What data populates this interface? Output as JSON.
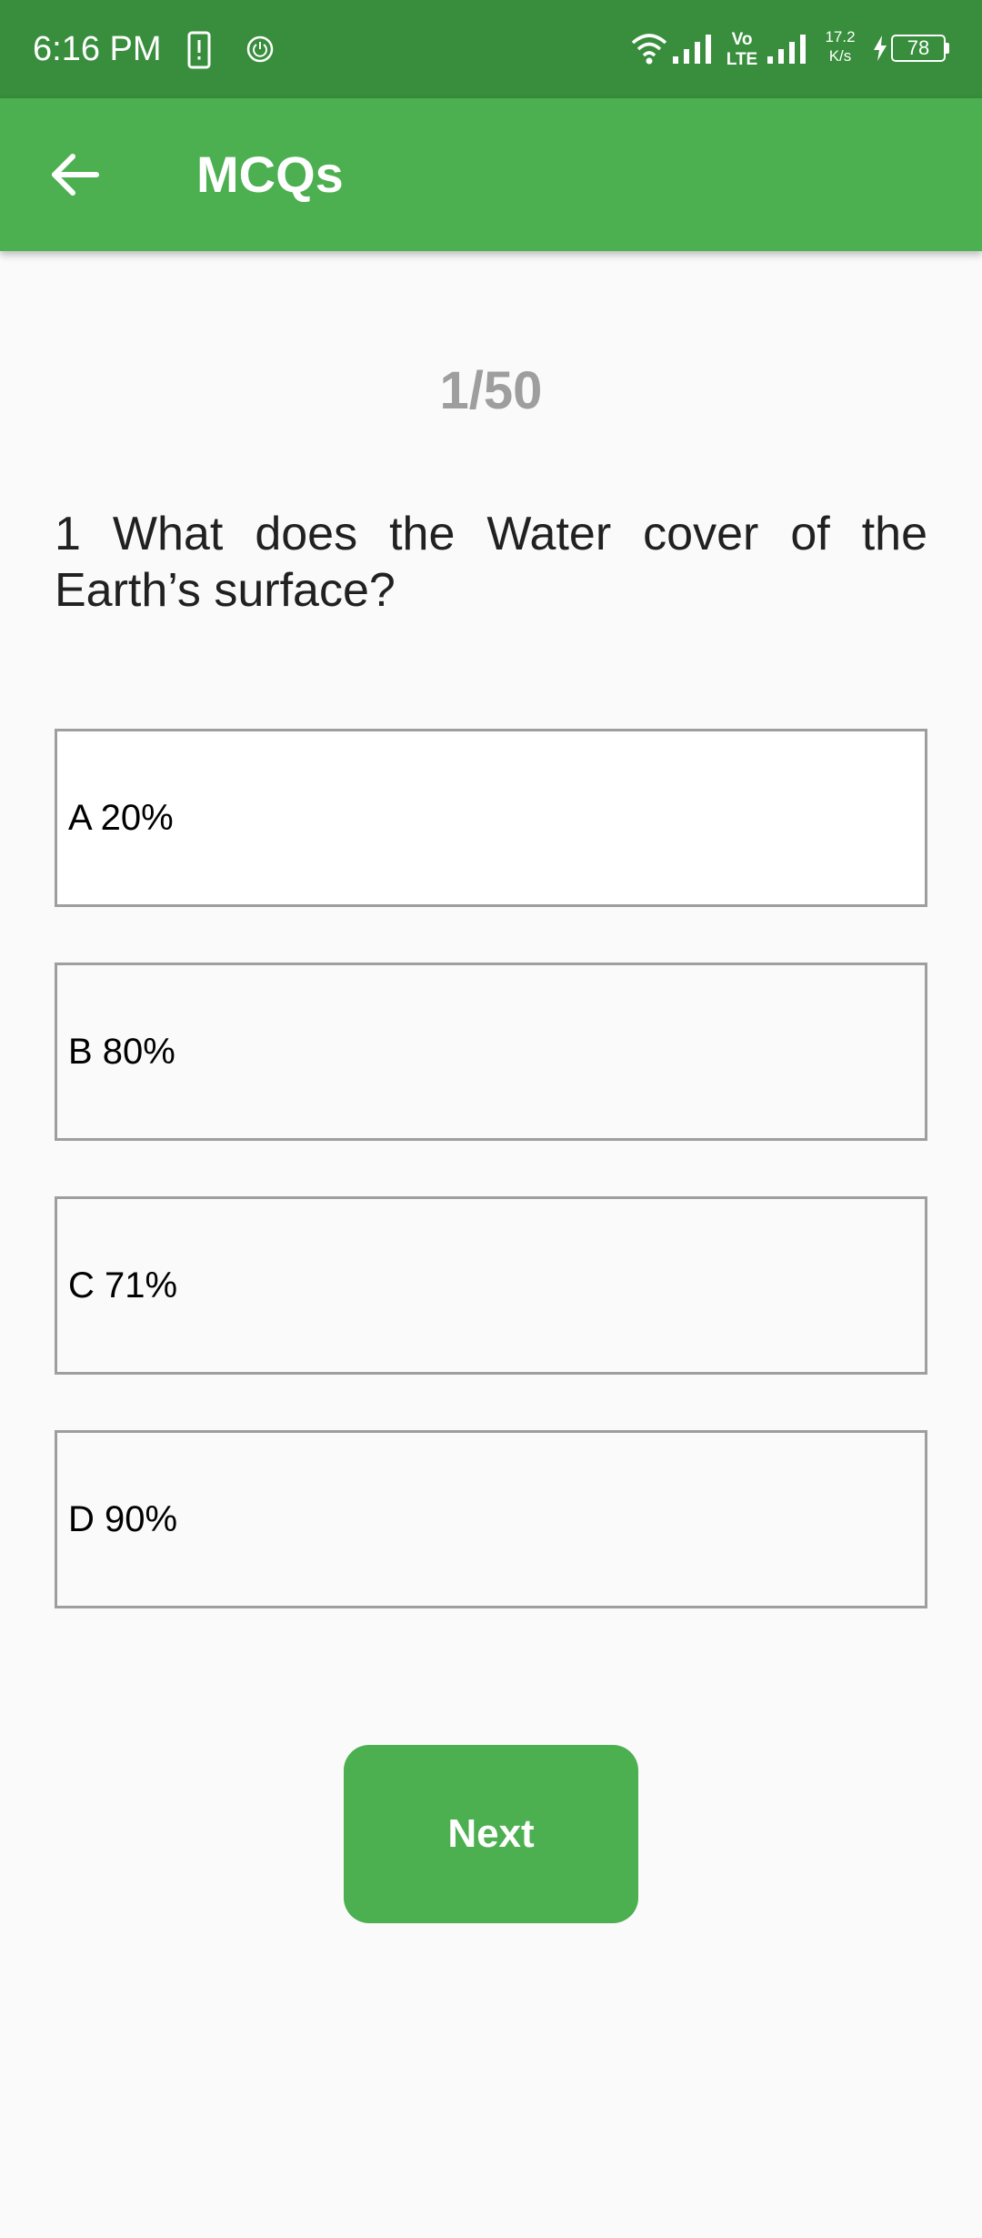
{
  "status_bar": {
    "time": "6:16 PM",
    "net_speed_value": "17.2",
    "net_speed_unit": "K/s",
    "battery_level": "78"
  },
  "app_bar": {
    "title": "MCQs",
    "back_icon": "arrow-back-icon"
  },
  "quiz": {
    "counter": "1/50",
    "question": "1 What does the Water cover of the Earth’s surface?",
    "options": [
      {
        "label": "A 20%"
      },
      {
        "label": "B 80%"
      },
      {
        "label": "C 71%"
      },
      {
        "label": "D 90%"
      }
    ],
    "next_label": "Next"
  },
  "colors": {
    "status_bar": "#388e3c",
    "app_bar": "#4caf50",
    "button": "#4caf50",
    "counter": "#9e9e9e",
    "option_border": "#9e9e9e"
  }
}
